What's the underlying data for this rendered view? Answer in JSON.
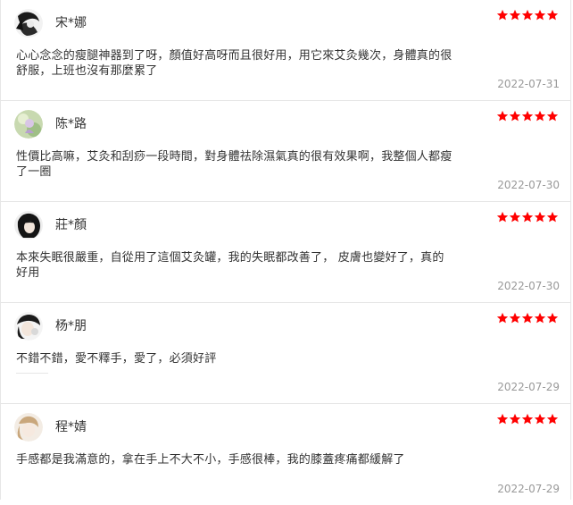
{
  "colors": {
    "star": "#ff0000",
    "date": "#999999",
    "divider": "#e6e6e6"
  },
  "star_icon": "star-icon",
  "reviews": [
    {
      "name": "宋*娜",
      "rating": 5,
      "content": "心心念念的瘦腿神器到了呀，顏值好高呀而且很好用，用它來艾灸幾次，身體真的很舒服，上班也沒有那麼累了",
      "date": "2022-07-31"
    },
    {
      "name": "陈*路",
      "rating": 5,
      "content": "性價比高嘛，艾灸和刮痧一段時間，對身體祛除濕氣真的很有效果啊，我整個人都瘦了一圈",
      "date": "2022-07-30"
    },
    {
      "name": "莊*顏",
      "rating": 5,
      "content": "本來失眠很嚴重，自從用了這個艾灸罐，我的失眠都改善了， 皮膚也變好了，真的好用",
      "date": "2022-07-30"
    },
    {
      "name": "杨*朋",
      "rating": 5,
      "content": "不錯不錯，愛不釋手，愛了，必須好評",
      "date": "2022-07-29"
    },
    {
      "name": "程*婧",
      "rating": 5,
      "content": "手感都是我滿意的，拿在手上不大不小，手感很棒，我的膝蓋疼痛都緩解了",
      "date": "2022-07-29"
    }
  ]
}
